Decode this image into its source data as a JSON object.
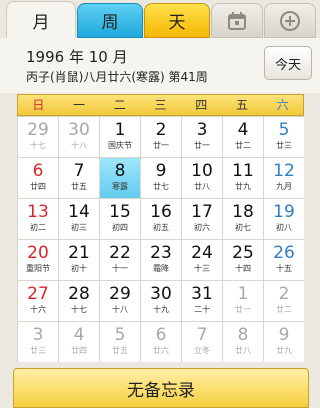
{
  "tabs": {
    "month": "月",
    "week": "周",
    "day": "天"
  },
  "icons": {
    "calendar": "calendar-icon",
    "add": "plus-circle-icon"
  },
  "header": {
    "date_line": "1996 年 10 月",
    "lunar_line": "丙子(肖鼠)八月廿六(寒露) 第41周",
    "today_button": "今天"
  },
  "weekdays": [
    "日",
    "一",
    "二",
    "三",
    "四",
    "五",
    "六"
  ],
  "cells": [
    {
      "num": "29",
      "sub": "十七",
      "other": true
    },
    {
      "num": "30",
      "sub": "十八",
      "other": true
    },
    {
      "num": "1",
      "sub": "国庆节"
    },
    {
      "num": "2",
      "sub": "廿一"
    },
    {
      "num": "3",
      "sub": "廿一"
    },
    {
      "num": "4",
      "sub": "廿二"
    },
    {
      "num": "5",
      "sub": "廿三"
    },
    {
      "num": "6",
      "sub": "廿四"
    },
    {
      "num": "7",
      "sub": "廿五"
    },
    {
      "num": "8",
      "sub": "寒露",
      "selected": true
    },
    {
      "num": "9",
      "sub": "廿七"
    },
    {
      "num": "10",
      "sub": "廿八"
    },
    {
      "num": "11",
      "sub": "廿九"
    },
    {
      "num": "12",
      "sub": "九月"
    },
    {
      "num": "13",
      "sub": "初二"
    },
    {
      "num": "14",
      "sub": "初三"
    },
    {
      "num": "15",
      "sub": "初四"
    },
    {
      "num": "16",
      "sub": "初五"
    },
    {
      "num": "17",
      "sub": "初六"
    },
    {
      "num": "18",
      "sub": "初七"
    },
    {
      "num": "19",
      "sub": "初八"
    },
    {
      "num": "20",
      "sub": "重阳节"
    },
    {
      "num": "21",
      "sub": "初十"
    },
    {
      "num": "22",
      "sub": "十一"
    },
    {
      "num": "23",
      "sub": "霜降"
    },
    {
      "num": "24",
      "sub": "十三"
    },
    {
      "num": "25",
      "sub": "十四"
    },
    {
      "num": "26",
      "sub": "十五"
    },
    {
      "num": "27",
      "sub": "十六"
    },
    {
      "num": "28",
      "sub": "十七"
    },
    {
      "num": "29",
      "sub": "十八"
    },
    {
      "num": "30",
      "sub": "十九"
    },
    {
      "num": "31",
      "sub": "二十"
    },
    {
      "num": "1",
      "sub": "廿一",
      "other": true
    },
    {
      "num": "2",
      "sub": "廿二",
      "other": true
    },
    {
      "num": "3",
      "sub": "廿三",
      "other": true
    },
    {
      "num": "4",
      "sub": "廿四",
      "other": true
    },
    {
      "num": "5",
      "sub": "廿五",
      "other": true
    },
    {
      "num": "6",
      "sub": "廿六",
      "other": true
    },
    {
      "num": "7",
      "sub": "立冬",
      "other": true
    },
    {
      "num": "8",
      "sub": "廿八",
      "other": true
    },
    {
      "num": "9",
      "sub": "廿九",
      "other": true
    }
  ],
  "memo": "无备忘录",
  "colors": {
    "sunday": "#d7272c",
    "saturday": "#2d7fc4",
    "selected": "#63cbee",
    "week_tab": "#1fa9dd",
    "day_tab": "#f5b800"
  }
}
